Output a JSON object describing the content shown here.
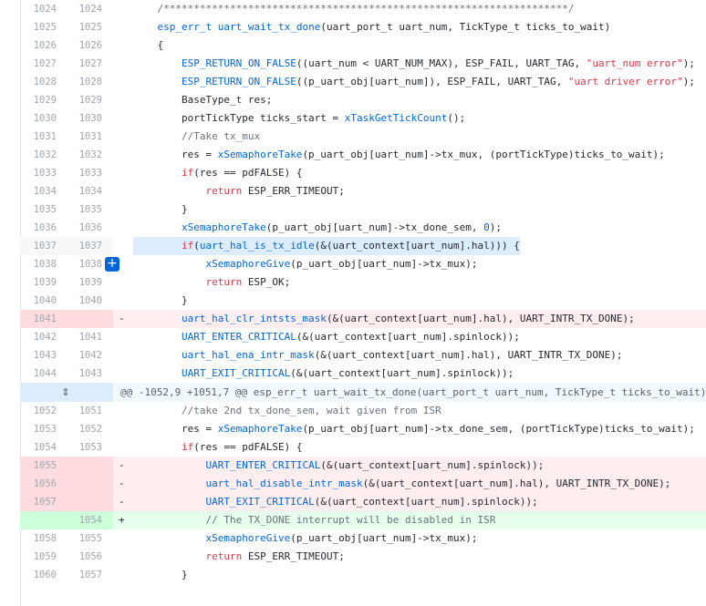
{
  "diff": {
    "add_line_button_label": "+",
    "expand_icon": "⇕",
    "lines": [
      {
        "type": "ctx",
        "old": "1024",
        "new": "1024",
        "marker": "",
        "code": "    /*******************************************************************/"
      },
      {
        "type": "ctx",
        "old": "1025",
        "new": "1025",
        "marker": "",
        "code": "    esp_err_t uart_wait_tx_done(uart_port_t uart_num, TickType_t ticks_to_wait)"
      },
      {
        "type": "ctx",
        "old": "1026",
        "new": "1026",
        "marker": "",
        "code": "    {"
      },
      {
        "type": "ctx",
        "old": "1027",
        "new": "1027",
        "marker": "",
        "code": "        ESP_RETURN_ON_FALSE((uart_num < UART_NUM_MAX), ESP_FAIL, UART_TAG, \"uart_num error\");"
      },
      {
        "type": "ctx",
        "old": "1028",
        "new": "1028",
        "marker": "",
        "code": "        ESP_RETURN_ON_FALSE((p_uart_obj[uart_num]), ESP_FAIL, UART_TAG, \"uart driver error\");"
      },
      {
        "type": "ctx",
        "old": "1029",
        "new": "1029",
        "marker": "",
        "code": "        BaseType_t res;"
      },
      {
        "type": "ctx",
        "old": "1030",
        "new": "1030",
        "marker": "",
        "code": "        portTickType ticks_start = xTaskGetTickCount();"
      },
      {
        "type": "ctx",
        "old": "1031",
        "new": "1031",
        "marker": "",
        "code": "        //Take tx_mux"
      },
      {
        "type": "ctx",
        "old": "1032",
        "new": "1032",
        "marker": "",
        "code": "        res = xSemaphoreTake(p_uart_obj[uart_num]->tx_mux, (portTickType)ticks_to_wait);"
      },
      {
        "type": "ctx",
        "old": "1033",
        "new": "1033",
        "marker": "",
        "code": "        if(res == pdFALSE) {"
      },
      {
        "type": "ctx",
        "old": "1034",
        "new": "1034",
        "marker": "",
        "code": "            return ESP_ERR_TIMEOUT;"
      },
      {
        "type": "ctx",
        "old": "1035",
        "new": "1035",
        "marker": "",
        "code": "        }"
      },
      {
        "type": "ctx",
        "old": "1036",
        "new": "1036",
        "marker": "",
        "code": "        xSemaphoreTake(p_uart_obj[uart_num]->tx_done_sem, 0);"
      },
      {
        "type": "hl",
        "old": "1037",
        "new": "1037",
        "marker": "",
        "code": "        if(uart_hal_is_tx_idle(&(uart_context[uart_num].hal))) {"
      },
      {
        "type": "ctx",
        "old": "1038",
        "new": "1038",
        "marker": "",
        "code": "            xSemaphoreGive(p_uart_obj[uart_num]->tx_mux);"
      },
      {
        "type": "ctx",
        "old": "1039",
        "new": "1039",
        "marker": "",
        "code": "            return ESP_OK;"
      },
      {
        "type": "ctx",
        "old": "1040",
        "new": "1040",
        "marker": "",
        "code": "        }"
      },
      {
        "type": "del",
        "old": "1041",
        "new": "",
        "marker": "-",
        "code": "        uart_hal_clr_intsts_mask(&(uart_context[uart_num].hal), UART_INTR_TX_DONE);"
      },
      {
        "type": "ctx",
        "old": "1042",
        "new": "1041",
        "marker": "",
        "code": "        UART_ENTER_CRITICAL(&(uart_context[uart_num].spinlock));"
      },
      {
        "type": "ctx",
        "old": "1043",
        "new": "1042",
        "marker": "",
        "code": "        uart_hal_ena_intr_mask(&(uart_context[uart_num].hal), UART_INTR_TX_DONE);"
      },
      {
        "type": "ctx",
        "old": "1044",
        "new": "1043",
        "marker": "",
        "code": "        UART_EXIT_CRITICAL(&(uart_context[uart_num].spinlock));"
      },
      {
        "type": "hunk",
        "old": "",
        "new": "",
        "marker": "",
        "code": "@@ -1052,9 +1051,7 @@ esp_err_t uart_wait_tx_done(uart_port_t uart_num, TickType_t ticks_to_wait)"
      },
      {
        "type": "ctx",
        "old": "1052",
        "new": "1051",
        "marker": "",
        "code": "        //take 2nd tx_done_sem, wait given from ISR"
      },
      {
        "type": "ctx",
        "old": "1053",
        "new": "1052",
        "marker": "",
        "code": "        res = xSemaphoreTake(p_uart_obj[uart_num]->tx_done_sem, (portTickType)ticks_to_wait);"
      },
      {
        "type": "ctx",
        "old": "1054",
        "new": "1053",
        "marker": "",
        "code": "        if(res == pdFALSE) {"
      },
      {
        "type": "del",
        "old": "1055",
        "new": "",
        "marker": "-",
        "code": "            UART_ENTER_CRITICAL(&(uart_context[uart_num].spinlock));"
      },
      {
        "type": "del",
        "old": "1056",
        "new": "",
        "marker": "-",
        "code": "            uart_hal_disable_intr_mask(&(uart_context[uart_num].hal), UART_INTR_TX_DONE);"
      },
      {
        "type": "del",
        "old": "1057",
        "new": "",
        "marker": "-",
        "code": "            UART_EXIT_CRITICAL(&(uart_context[uart_num].spinlock));"
      },
      {
        "type": "add",
        "old": "",
        "new": "1054",
        "marker": "+",
        "code": "            // The TX_DONE interrupt will be disabled in ISR"
      },
      {
        "type": "ctx",
        "old": "1058",
        "new": "1055",
        "marker": "",
        "code": "            xSemaphoreGive(p_uart_obj[uart_num]->tx_mux);"
      },
      {
        "type": "ctx",
        "old": "1059",
        "new": "1056",
        "marker": "",
        "code": "            return ESP_ERR_TIMEOUT;"
      },
      {
        "type": "ctx",
        "old": "1060",
        "new": "1057",
        "marker": "",
        "code": "        }"
      }
    ]
  }
}
